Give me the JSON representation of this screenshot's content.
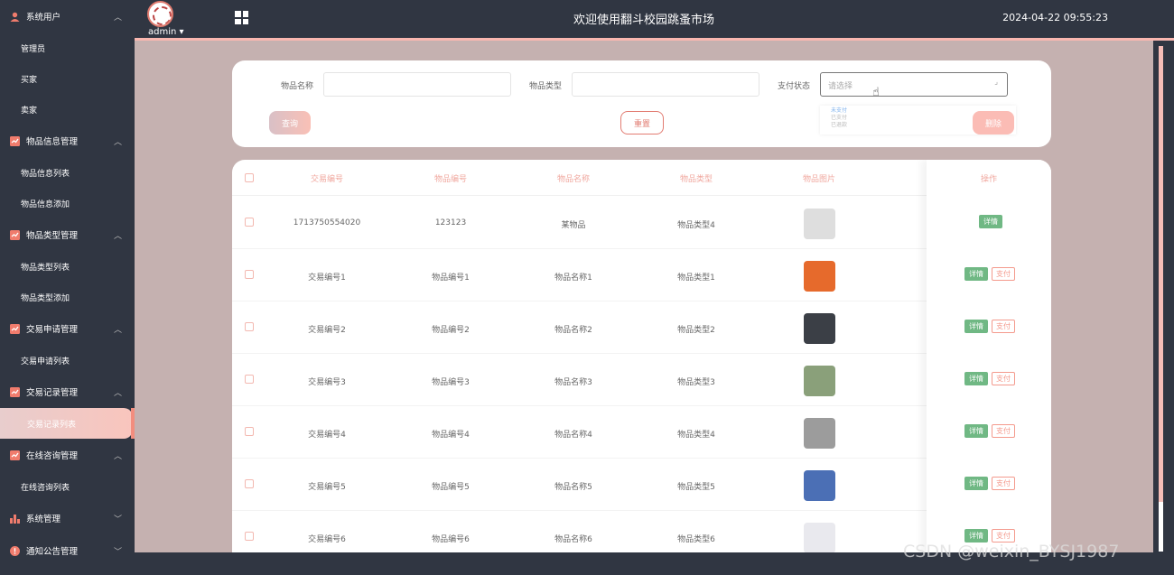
{
  "sidebar": {
    "groups": [
      {
        "label": "系统用户",
        "icon": "user-icon",
        "chevron": "up",
        "items": [
          "管理员",
          "买家",
          "卖家"
        ]
      },
      {
        "label": "物品信息管理",
        "icon": "chart-check-icon",
        "chevron": "up",
        "items": [
          "物品信息列表",
          "物品信息添加"
        ]
      },
      {
        "label": "物品类型管理",
        "icon": "chart-check-icon",
        "chevron": "up",
        "items": [
          "物品类型列表",
          "物品类型添加"
        ]
      },
      {
        "label": "交易申请管理",
        "icon": "chart-check-icon",
        "chevron": "up",
        "items": [
          "交易申请列表"
        ]
      },
      {
        "label": "交易记录管理",
        "icon": "chart-check-icon",
        "chevron": "up",
        "items": [
          "交易记录列表"
        ]
      },
      {
        "label": "在线咨询管理",
        "icon": "chart-check-icon",
        "chevron": "up",
        "items": [
          "在线咨询列表"
        ]
      },
      {
        "label": "系统管理",
        "icon": "bar-chart-icon",
        "chevron": "down",
        "items": []
      },
      {
        "label": "通知公告管理",
        "icon": "info-icon",
        "chevron": "down",
        "items": []
      }
    ],
    "active_item": "交易记录列表"
  },
  "header": {
    "user": "admin",
    "title": "欢迎使用翻斗校园跳蚤市场",
    "datetime": "2024-04-22 09:55:23"
  },
  "search": {
    "name_label": "物品名称",
    "type_label": "物品类型",
    "pay_label": "支付状态",
    "pay_placeholder": "请选择",
    "pay_options": [
      "未支付",
      "已支付",
      "已退款"
    ],
    "query_btn": "查询",
    "reset_btn": "重置",
    "delete_btn": "删除"
  },
  "table": {
    "headers": [
      "交易编号",
      "物品编号",
      "物品名称",
      "物品类型",
      "物品图片",
      "操作"
    ],
    "rows": [
      {
        "trade_no": "1713750554020",
        "item_no": "123123",
        "item_name": "某物品",
        "item_type": "物品类型4",
        "img": "#dedede",
        "pay": false
      },
      {
        "trade_no": "交易编号1",
        "item_no": "物品编号1",
        "item_name": "物品名称1",
        "item_type": "物品类型1",
        "img": "#e66a2c",
        "pay": true
      },
      {
        "trade_no": "交易编号2",
        "item_no": "物品编号2",
        "item_name": "物品名称2",
        "item_type": "物品类型2",
        "img": "#3b3f46",
        "pay": true
      },
      {
        "trade_no": "交易编号3",
        "item_no": "物品编号3",
        "item_name": "物品名称3",
        "item_type": "物品类型3",
        "img": "#8aa07a",
        "pay": true
      },
      {
        "trade_no": "交易编号4",
        "item_no": "物品编号4",
        "item_name": "物品名称4",
        "item_type": "物品类型4",
        "img": "#9c9c9c",
        "pay": true
      },
      {
        "trade_no": "交易编号5",
        "item_no": "物品编号5",
        "item_name": "物品名称5",
        "item_type": "物品类型5",
        "img": "#4b6fb5",
        "pay": true
      },
      {
        "trade_no": "交易编号6",
        "item_no": "物品编号6",
        "item_name": "物品名称6",
        "item_type": "物品类型6",
        "img": "#e9e9ee",
        "pay": true
      }
    ],
    "detail_btn": "详情",
    "pay_btn": "支付"
  },
  "watermark": "CSDN @weixin_BYSJ1987"
}
